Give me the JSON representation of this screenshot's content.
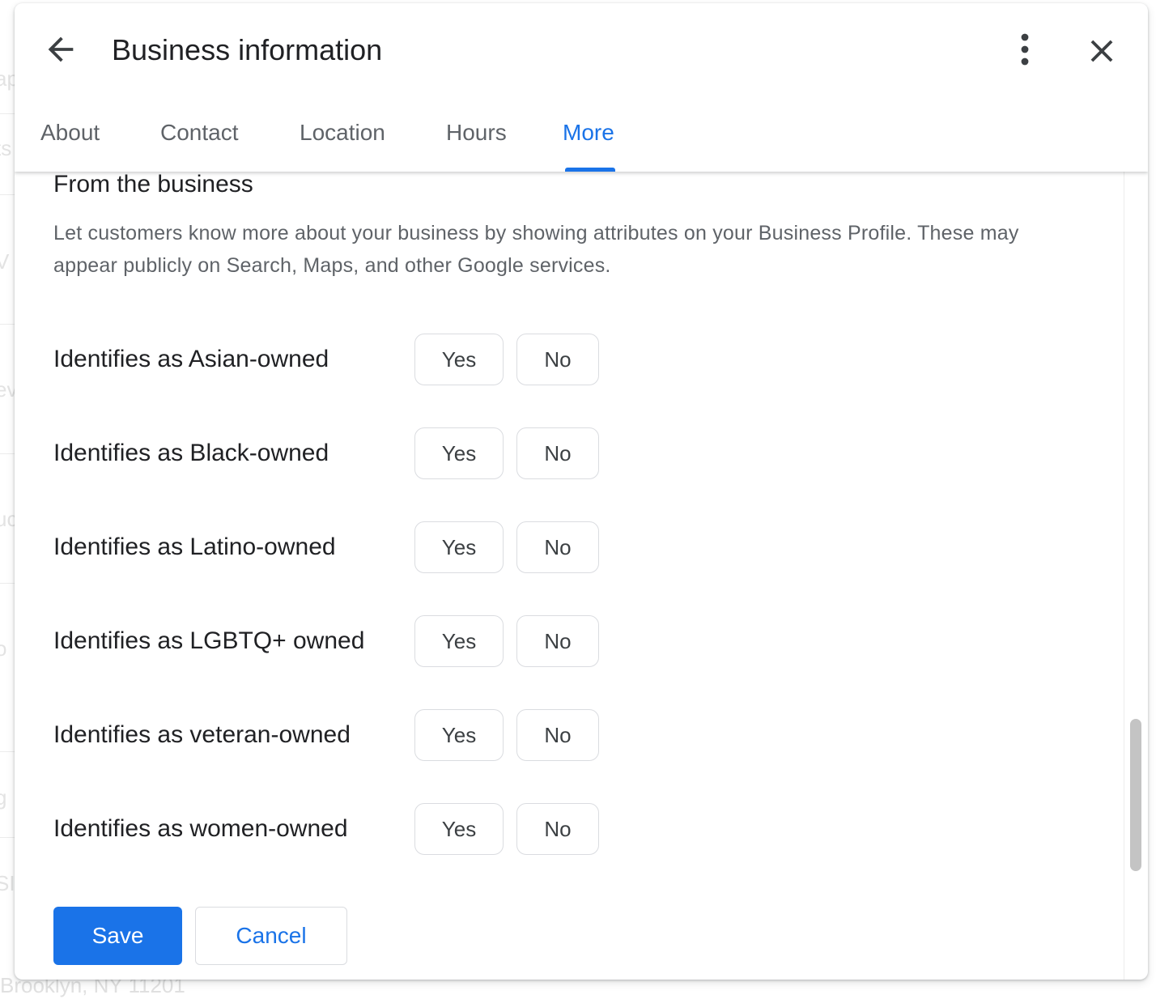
{
  "background": {
    "fragments": [
      "ap",
      "ts",
      "V",
      "ev",
      "uc",
      "o",
      "g",
      "SI"
    ],
    "address": "Brooklyn, NY 11201"
  },
  "dialog": {
    "title": "Business information",
    "back_icon": "arrow-back-icon",
    "more_icon": "more-vert-icon",
    "close_icon": "close-icon",
    "tabs": [
      {
        "label": "About",
        "active": false
      },
      {
        "label": "Contact",
        "active": false
      },
      {
        "label": "Location",
        "active": false
      },
      {
        "label": "Hours",
        "active": false
      },
      {
        "label": "More",
        "active": true
      }
    ],
    "section_title": "From the business",
    "description": "Let customers know more about your business by showing attributes on your Business Profile. These may appear publicly on Search, Maps, and other Google services.",
    "attributes": [
      {
        "label": "Identifies as Asian-owned",
        "yes": "Yes",
        "no": "No"
      },
      {
        "label": "Identifies as Black-owned",
        "yes": "Yes",
        "no": "No"
      },
      {
        "label": "Identifies as Latino-owned",
        "yes": "Yes",
        "no": "No"
      },
      {
        "label": "Identifies as LGBTQ+ owned",
        "yes": "Yes",
        "no": "No"
      },
      {
        "label": "Identifies as veteran-owned",
        "yes": "Yes",
        "no": "No"
      },
      {
        "label": "Identifies as women-owned",
        "yes": "Yes",
        "no": "No"
      }
    ],
    "save_label": "Save",
    "cancel_label": "Cancel"
  },
  "colors": {
    "accent": "#1a73e8",
    "text_primary": "#202124",
    "text_secondary": "#5f6368",
    "border": "#dadce0"
  }
}
